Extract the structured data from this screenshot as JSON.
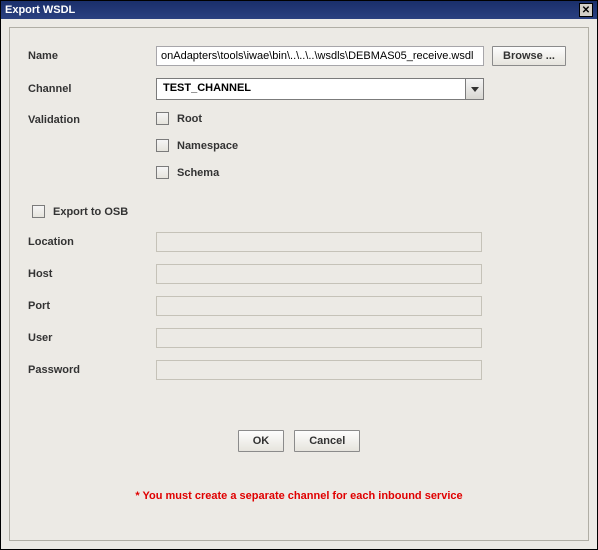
{
  "title": "Export WSDL",
  "labels": {
    "name": "Name",
    "channel": "Channel",
    "validation": "Validation",
    "exportOsb": "Export to OSB",
    "location": "Location",
    "host": "Host",
    "port": "Port",
    "user": "User",
    "password": "Password"
  },
  "fields": {
    "nameValue": "onAdapters\\tools\\iwae\\bin\\..\\..\\..\\wsdls\\DEBMAS05_receive.wsdl",
    "channelSelected": "TEST_CHANNEL",
    "locationValue": "",
    "hostValue": "",
    "portValue": "",
    "userValue": "",
    "passwordValue": ""
  },
  "validation": {
    "root": "Root",
    "namespace": "Namespace",
    "schema": "Schema"
  },
  "buttons": {
    "browse": "Browse ...",
    "ok": "OK",
    "cancel": "Cancel"
  },
  "footer": "* You must create a separate channel for each inbound service"
}
